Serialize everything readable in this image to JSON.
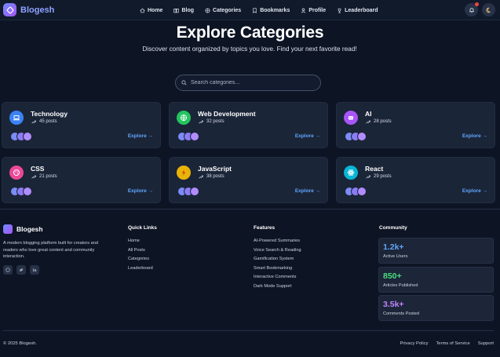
{
  "nav": {
    "brand": "Blogesh",
    "links": [
      {
        "label": "Home",
        "icon": "home-icon"
      },
      {
        "label": "Blog",
        "icon": "book-icon"
      },
      {
        "label": "Categories",
        "icon": "grid-icon"
      },
      {
        "label": "Bookmarks",
        "icon": "bookmark-icon"
      },
      {
        "label": "Profile",
        "icon": "user-icon"
      },
      {
        "label": "Leaderboard",
        "icon": "trophy-icon"
      }
    ]
  },
  "hero": {
    "title": "Explore Categories",
    "subtitle": "Discover content organized by topics you love. Find your next favorite read!",
    "search_placeholder": "Search categories..."
  },
  "categories": [
    {
      "name": "Technology",
      "posts": "45 posts",
      "explore": "Explore →",
      "color": "#3b82f6",
      "icon": "laptop-icon"
    },
    {
      "name": "Web Development",
      "posts": "32 posts",
      "explore": "Explore →",
      "color": "#22c55e",
      "icon": "globe-icon"
    },
    {
      "name": "AI",
      "posts": "28 posts",
      "explore": "Explore →",
      "color": "#a855f7",
      "icon": "robot-icon"
    },
    {
      "name": "CSS",
      "posts": "21 posts",
      "explore": "Explore →",
      "color": "#ec4899",
      "icon": "palette-icon"
    },
    {
      "name": "JavaScript",
      "posts": "38 posts",
      "explore": "Explore →",
      "color": "#eab308",
      "icon": "bolt-icon"
    },
    {
      "name": "React",
      "posts": "29 posts",
      "explore": "Explore →",
      "color": "#06b6d4",
      "icon": "atom-icon"
    }
  ],
  "footer": {
    "brand": "Blogesh",
    "description": "A modern blogging platform built for creators and readers who love great content and community interaction.",
    "quick_links_title": "Quick Links",
    "quick_links": [
      "Home",
      "All Posts",
      "Categories",
      "Leaderboard"
    ],
    "features_title": "Features",
    "features": [
      "AI-Powered Summaries",
      "Voice Search & Reading",
      "Gamification System",
      "Smart Bookmarking",
      "Interactive Comments",
      "Dark Mode Support"
    ],
    "community_title": "Community",
    "stats": [
      {
        "value": "1.2k+",
        "label": "Active Users",
        "color": "#60a5fa"
      },
      {
        "value": "850+",
        "label": "Articles Published",
        "color": "#4ade80"
      },
      {
        "value": "3.5k+",
        "label": "Comments Posted",
        "color": "#c084fc"
      }
    ],
    "copyright": "© 2025 Blogesh.",
    "legal": [
      "Privacy Policy",
      "Terms of Service",
      "Support"
    ]
  }
}
